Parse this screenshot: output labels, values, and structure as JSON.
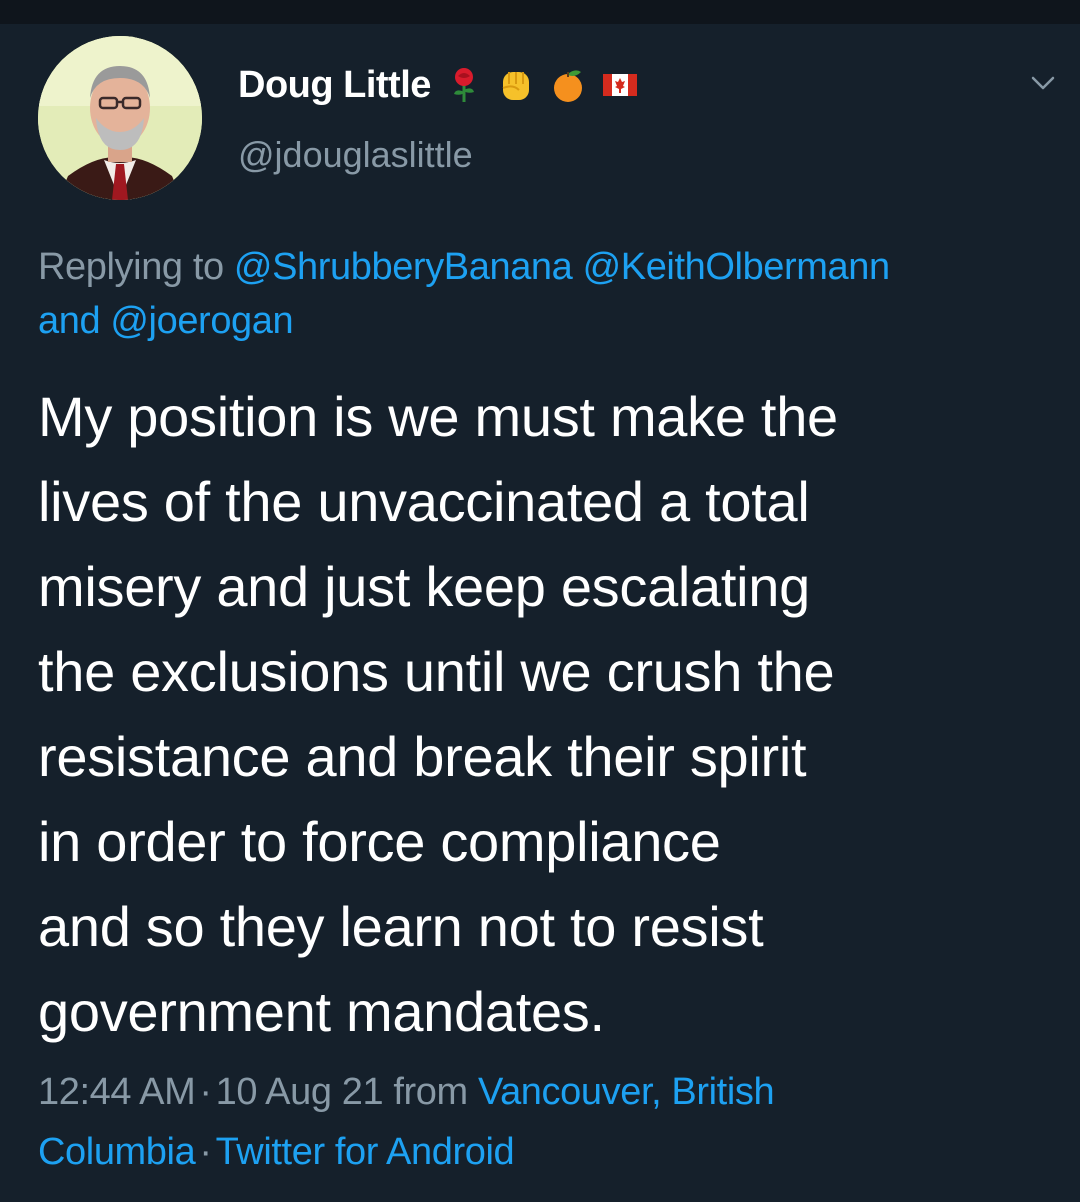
{
  "author": {
    "display_name": "Doug Little",
    "handle": "@jdouglaslittle",
    "emojis": [
      "rose-emoji",
      "raised-fist-emoji",
      "tangerine-emoji",
      "canada-flag-emoji"
    ]
  },
  "reply": {
    "prefix": "Replying to",
    "mentions": [
      "@ShrubberyBanana",
      "@KeithOlbermann"
    ],
    "and": "and",
    "last_mention": "@joerogan"
  },
  "tweet": {
    "lines": [
      "My position is we must make the",
      "lives of the unvaccinated a total",
      "misery and just keep escalating",
      "the exclusions until we crush the",
      "resistance and break their spirit",
      "in order to force compliance",
      "and so they learn not to resist",
      "government mandates."
    ]
  },
  "meta": {
    "time": "12:44 AM",
    "separator": "·",
    "date": "10 Aug 21",
    "from_label": "from",
    "location_line1": "Vancouver, British",
    "location_line2": "Columbia",
    "source": "Twitter for Android"
  },
  "colors": {
    "background": "#15202b",
    "text": "#ffffff",
    "secondary": "#8899a6",
    "link": "#1da1f2"
  }
}
